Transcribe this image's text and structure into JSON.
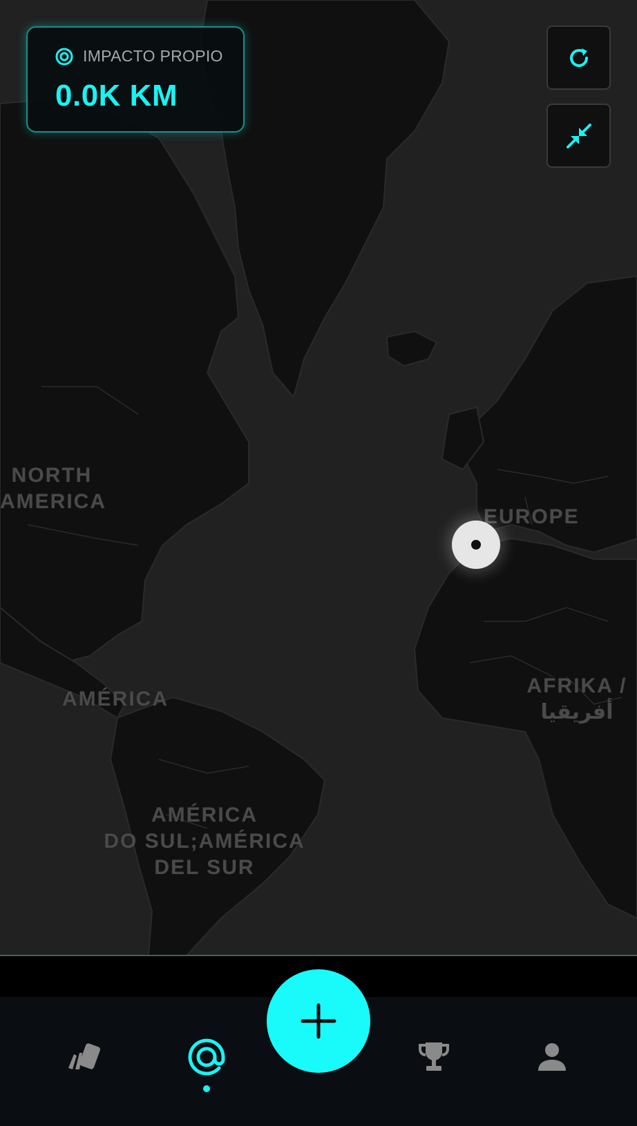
{
  "impact": {
    "label": "IMPACTO PROPIO",
    "value": "0.0K KM",
    "icon": "target-icon"
  },
  "map": {
    "labels": {
      "north_america": [
        "NORTH",
        "AMERICA"
      ],
      "europe": "EUROPE",
      "afrika": [
        "AFRIKA /",
        "أفريقيا"
      ],
      "america": "AMÉRICA",
      "south_america": [
        "AMÉRICA",
        "DO SUL;AMÉRICA",
        "DEL SUR"
      ]
    },
    "controls": [
      {
        "name": "refresh-button",
        "icon": "refresh-icon"
      },
      {
        "name": "collapse-button",
        "icon": "collapse-arrows-icon"
      }
    ]
  },
  "nav": {
    "items": [
      {
        "name": "cards",
        "icon": "cards-icon"
      },
      {
        "name": "radar",
        "icon": "at-target-icon",
        "active": true
      },
      {
        "name": "add",
        "icon": "plus-icon"
      },
      {
        "name": "trophy",
        "icon": "trophy-icon"
      },
      {
        "name": "profile",
        "icon": "person-icon"
      }
    ]
  },
  "colors": {
    "accent": "#19f3f3",
    "map_bg": "#212121",
    "land": "#101010",
    "nav_bg": "#0a0d12",
    "inactive_icon": "#8a8a8a"
  }
}
